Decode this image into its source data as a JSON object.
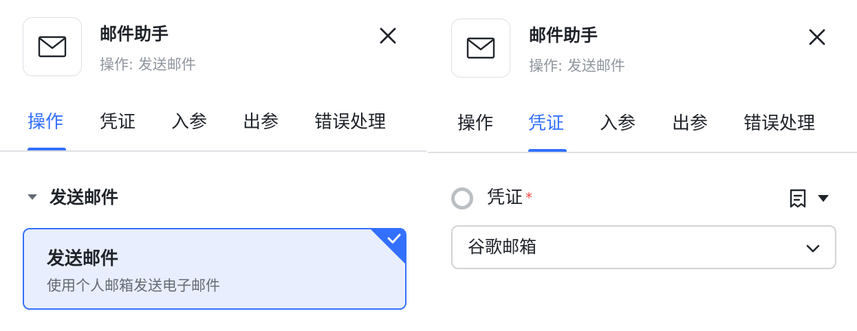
{
  "left_panel": {
    "header": {
      "icon": "mail-icon",
      "title": "邮件助手",
      "subtitle": "操作: 发送邮件",
      "close_icon": "close-icon"
    },
    "tabs": [
      {
        "label": "操作",
        "active": true
      },
      {
        "label": "凭证",
        "active": false
      },
      {
        "label": "入参",
        "active": false
      },
      {
        "label": "出参",
        "active": false
      },
      {
        "label": "错误处理",
        "active": false
      }
    ],
    "section": {
      "title": "发送邮件",
      "expanded": true
    },
    "option": {
      "title": "发送邮件",
      "description": "使用个人邮箱发送电子邮件",
      "selected": true,
      "check_icon": "check-icon"
    }
  },
  "right_panel": {
    "header": {
      "icon": "mail-icon",
      "title": "邮件助手",
      "subtitle": "操作: 发送邮件",
      "close_icon": "close-icon"
    },
    "tabs": [
      {
        "label": "操作",
        "active": false
      },
      {
        "label": "凭证",
        "active": true
      },
      {
        "label": "入参",
        "active": false
      },
      {
        "label": "出参",
        "active": false
      },
      {
        "label": "错误处理",
        "active": false
      }
    ],
    "credential": {
      "label": "凭证",
      "required_mark": "*",
      "selected_value": "谷歌邮箱",
      "tool_icon": "receipt-icon",
      "dropdown_icon": "caret-down-icon",
      "chevron_icon": "chevron-down-icon"
    }
  },
  "colors": {
    "accent": "#3370ff",
    "selected_bg": "#e8eefd",
    "required": "#f54a45",
    "text_primary": "#1f2329",
    "text_secondary": "#8f959e"
  }
}
